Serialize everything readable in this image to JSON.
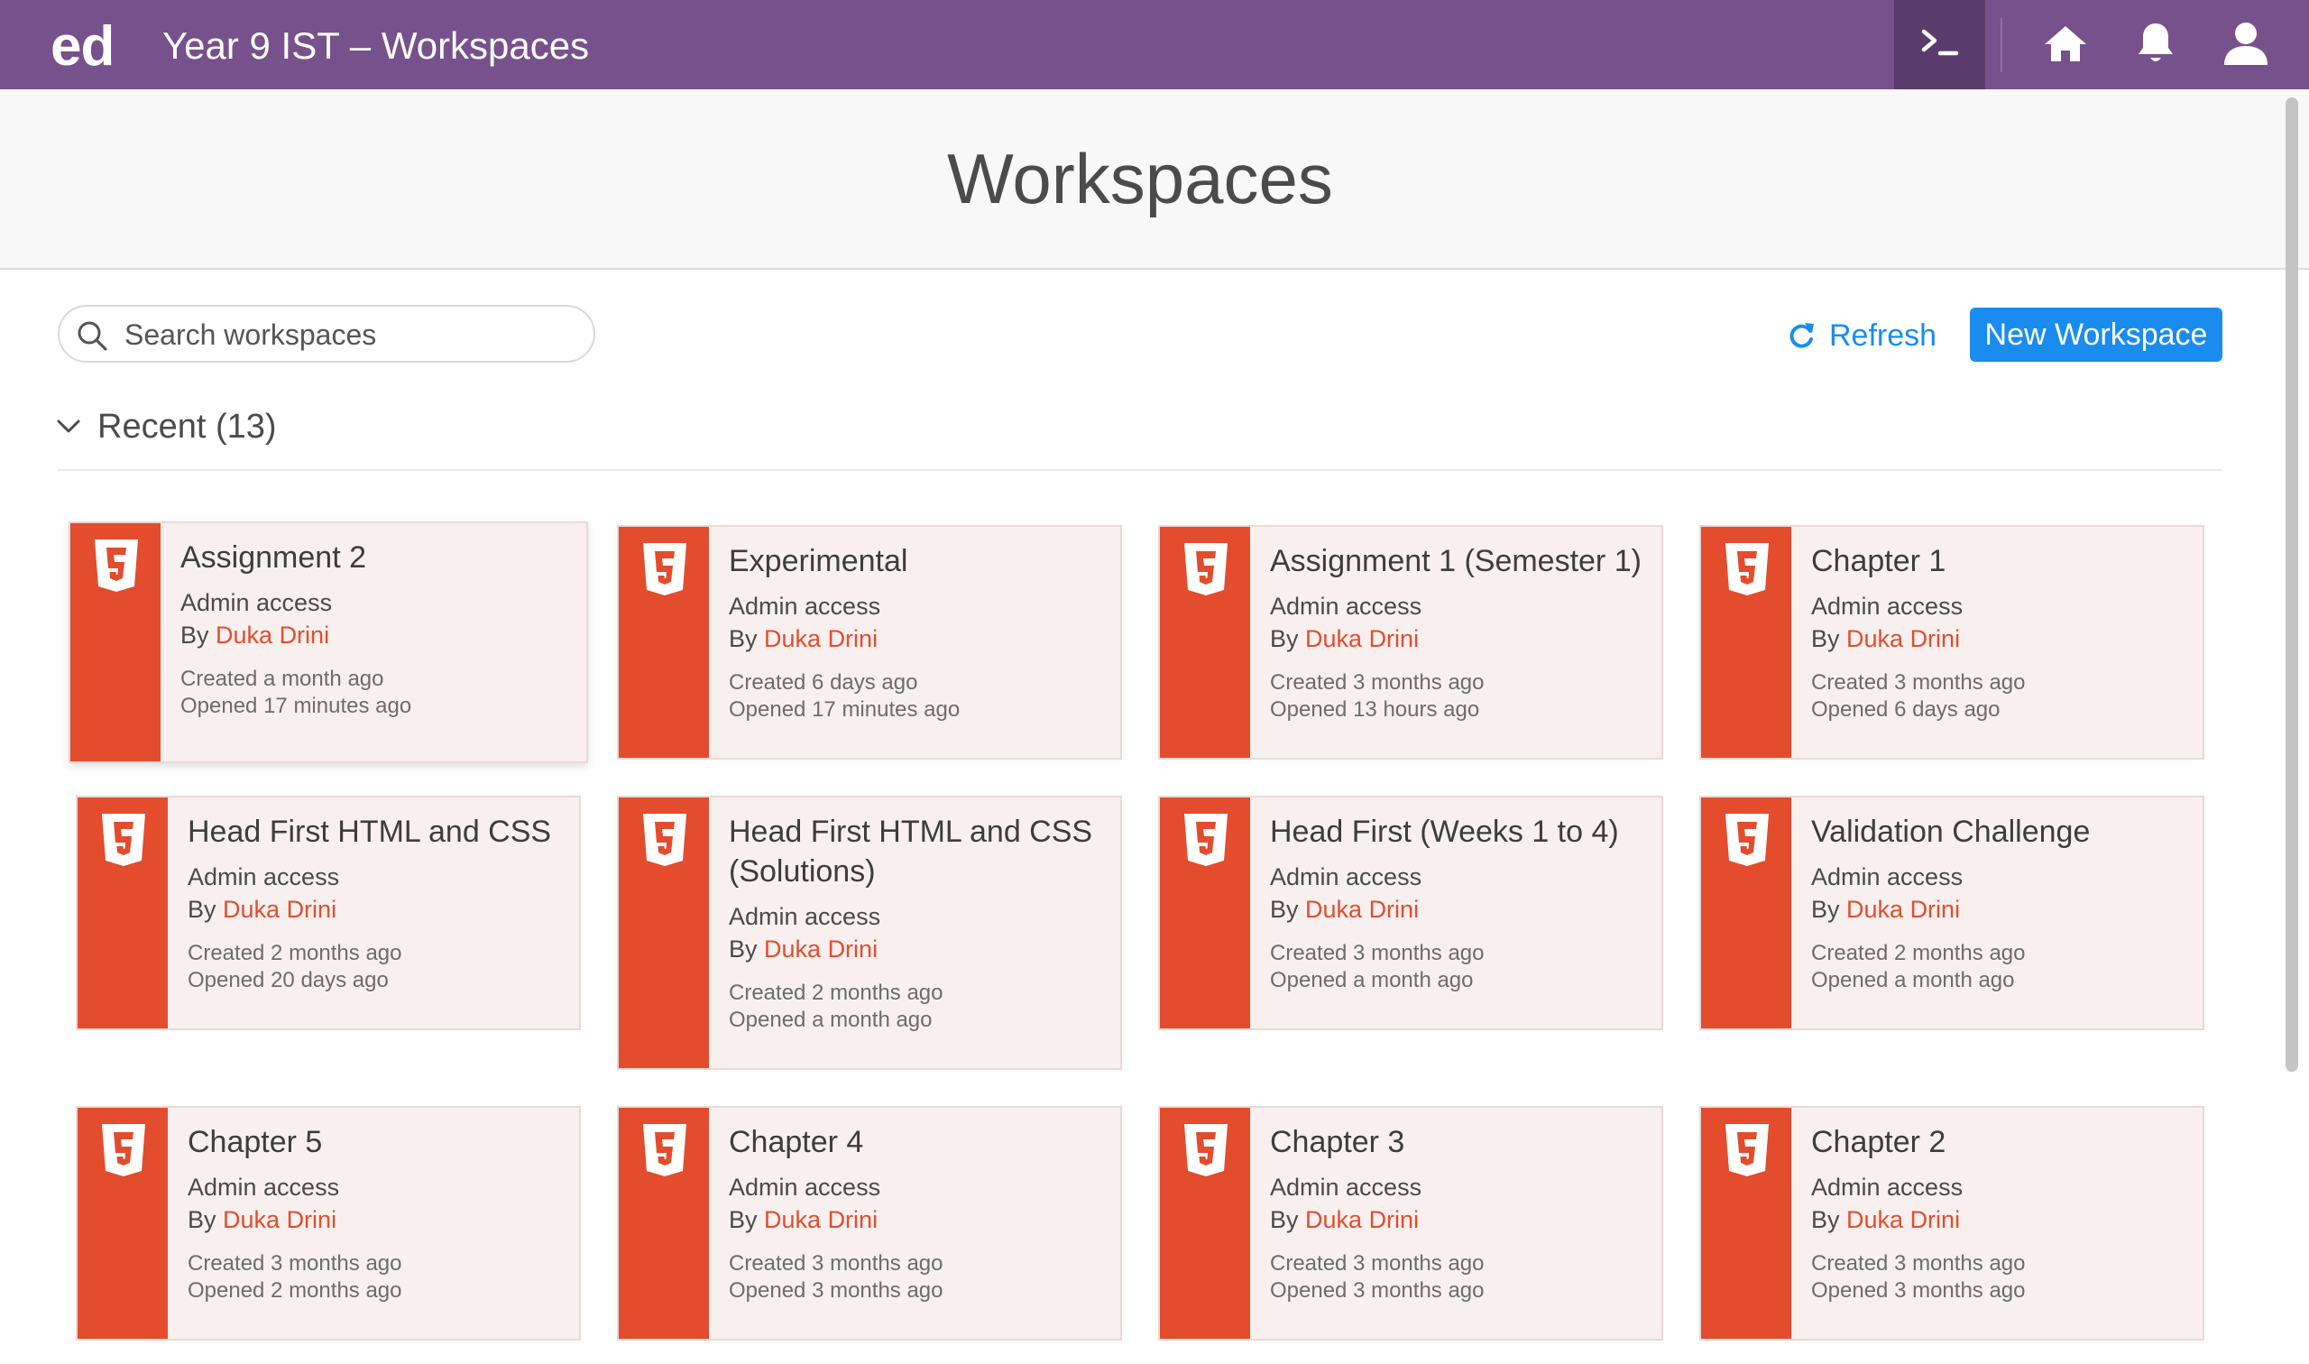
{
  "topbar": {
    "logo": "ed",
    "title": "Year 9 IST – Workspaces",
    "icons": [
      "terminal-icon",
      "home-icon",
      "bell-icon",
      "user-icon"
    ],
    "color": "#77518b"
  },
  "header": {
    "title": "Workspaces"
  },
  "toolbar": {
    "search_placeholder": "Search workspaces",
    "search_value": "",
    "refresh_label": "Refresh",
    "new_workspace_label": "New Workspace"
  },
  "section": {
    "label": "Recent (13)"
  },
  "colors": {
    "accent": "#1a8cef",
    "html5": "#e34c2d",
    "card_bg": "#f8f0ef"
  },
  "cards": [
    {
      "title": "Assignment 2",
      "access": "Admin access",
      "by": "By",
      "author": "Duka Drini",
      "created": "Created a month ago",
      "opened": "Opened 17 minutes ago"
    },
    {
      "title": "Experimental",
      "access": "Admin access",
      "by": "By",
      "author": "Duka Drini",
      "created": "Created 6 days ago",
      "opened": "Opened 17 minutes ago"
    },
    {
      "title": "Assignment 1 (Semester 1)",
      "access": "Admin access",
      "by": "By",
      "author": "Duka Drini",
      "created": "Created 3 months ago",
      "opened": "Opened 13 hours ago"
    },
    {
      "title": "Chapter 1",
      "access": "Admin access",
      "by": "By",
      "author": "Duka Drini",
      "created": "Created 3 months ago",
      "opened": "Opened 6 days ago"
    },
    {
      "title": "Head First HTML and CSS",
      "access": "Admin access",
      "by": "By",
      "author": "Duka Drini",
      "created": "Created 2 months ago",
      "opened": "Opened 20 days ago"
    },
    {
      "title": "Head First HTML and CSS (Solutions)",
      "access": "Admin access",
      "by": "By",
      "author": "Duka Drini",
      "created": "Created 2 months ago",
      "opened": "Opened a month ago"
    },
    {
      "title": "Head First (Weeks 1 to 4)",
      "access": "Admin access",
      "by": "By",
      "author": "Duka Drini",
      "created": "Created 3 months ago",
      "opened": "Opened a month ago"
    },
    {
      "title": "Validation Challenge",
      "access": "Admin access",
      "by": "By",
      "author": "Duka Drini",
      "created": "Created 2 months ago",
      "opened": "Opened a month ago"
    },
    {
      "title": "Chapter 5",
      "access": "Admin access",
      "by": "By",
      "author": "Duka Drini",
      "created": "Created 3 months ago",
      "opened": "Opened 2 months ago"
    },
    {
      "title": "Chapter 4",
      "access": "Admin access",
      "by": "By",
      "author": "Duka Drini",
      "created": "Created 3 months ago",
      "opened": "Opened 3 months ago"
    },
    {
      "title": "Chapter 3",
      "access": "Admin access",
      "by": "By",
      "author": "Duka Drini",
      "created": "Created 3 months ago",
      "opened": "Opened 3 months ago"
    },
    {
      "title": "Chapter 2",
      "access": "Admin access",
      "by": "By",
      "author": "Duka Drini",
      "created": "Created 3 months ago",
      "opened": "Opened 3 months ago"
    }
  ]
}
